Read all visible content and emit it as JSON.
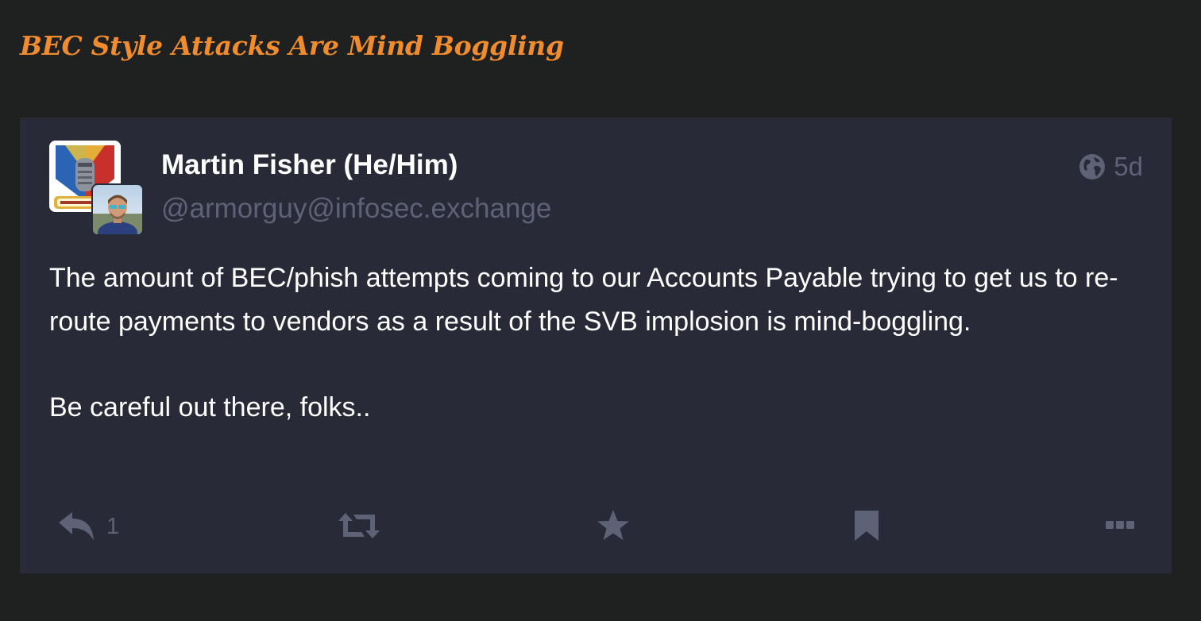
{
  "article": {
    "title": "BEC Style Attacks Are Mind Boggling"
  },
  "post": {
    "display_name": "Martin Fisher (He/Him)",
    "handle": "@armorguy@infosec.exchange",
    "timestamp": "5d",
    "visibility_icon": "globe-icon",
    "paragraphs": [
      "The amount of BEC/phish attempts coming to our Accounts Payable trying to get us to re-route payments to vendors as a result of the SVB implosion is mind-boggling.",
      "Be careful out there, folks.."
    ],
    "actions": {
      "reply_count": "1",
      "icons": [
        "reply-icon",
        "boost-icon",
        "favourite-icon",
        "bookmark-icon",
        "more-icon"
      ]
    }
  },
  "colors": {
    "page_background": "#1f2020",
    "card_background": "#282a37",
    "title_accent": "#f08b2e",
    "muted_text": "#5e6277",
    "body_text": "#ffffff"
  }
}
